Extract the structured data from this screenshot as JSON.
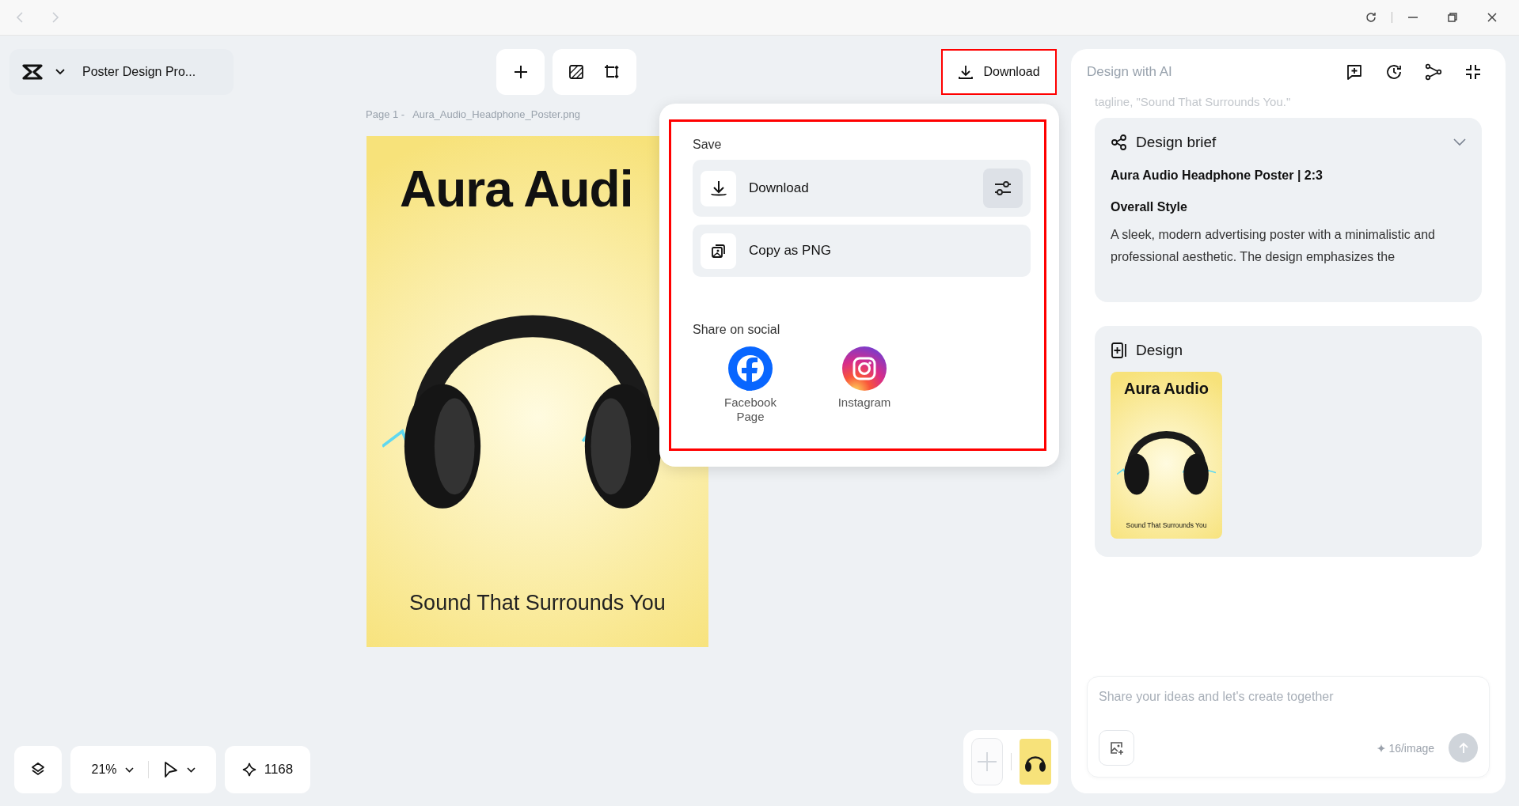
{
  "project": {
    "title": "Poster Design Pro..."
  },
  "download_button": {
    "label": "Download",
    "highlighted": true
  },
  "canvas": {
    "page_label": "Page 1 -",
    "file_name": "Aura_Audio_Headphone_Poster.png",
    "poster": {
      "headline": "Aura Audi",
      "tagline": "Sound That Surrounds You"
    }
  },
  "download_menu": {
    "highlighted": true,
    "save_heading": "Save",
    "save_items": [
      {
        "kind": "download",
        "label": "Download"
      },
      {
        "kind": "copy",
        "label": "Copy as PNG"
      }
    ],
    "share_heading": "Share on social",
    "share_targets": [
      {
        "kind": "facebook",
        "label": "Facebook Page"
      },
      {
        "kind": "instagram",
        "label": "Instagram"
      }
    ]
  },
  "bottom_toolbar": {
    "zoom": "21%",
    "credits": "1168"
  },
  "ai_panel": {
    "title": "Design with AI",
    "faded_text": "tagline, \"Sound That Surrounds You.\"",
    "brief": {
      "title": "Design brief",
      "heading": "Aura Audio Headphone Poster | 2:3",
      "subheading": "Overall Style",
      "body": "A sleek, modern advertising poster with a minimalistic and professional aesthetic. The design emphasizes the"
    },
    "design": {
      "title": "Design",
      "headline": "Aura Audio",
      "tagline": "Sound That Surrounds You"
    },
    "input": {
      "placeholder": "Share your ideas and let's create together",
      "cost": "16/image"
    }
  }
}
